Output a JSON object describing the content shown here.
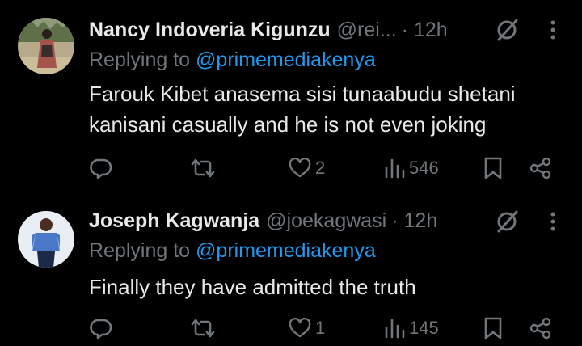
{
  "replies": [
    {
      "name": "Nancy Indoveria Kigunzu",
      "handle": "@rei...",
      "time": "· 12h",
      "replying_prefix": "Replying to ",
      "replying_to": "@primemediakenya",
      "text_lines": [
        "Farouk Kibet anasema sisi tunaabudu shetani",
        "kanisani casually and he is not even joking"
      ],
      "counts": {
        "reply": "",
        "repost": "",
        "like": "2",
        "views": "546"
      },
      "icons": [
        "reply-icon",
        "repost-icon",
        "like-icon",
        "views-icon",
        "bookmark-icon",
        "share-icon",
        "grok-icon",
        "more-icon"
      ]
    },
    {
      "name": "Joseph Kagwanja",
      "handle": "@joekagwasi",
      "time": "· 12h",
      "replying_prefix": "Replying to ",
      "replying_to": "@primemediakenya",
      "text_lines": [
        "Finally they have admitted the truth"
      ],
      "counts": {
        "reply": "",
        "repost": "",
        "like": "1",
        "views": "145"
      },
      "icons": [
        "reply-icon",
        "repost-icon",
        "like-icon",
        "views-icon",
        "bookmark-icon",
        "share-icon",
        "grok-icon",
        "more-icon"
      ]
    }
  ],
  "colors": {
    "background": "#000000",
    "text": "#e7e9ea",
    "muted": "#71767b",
    "link": "#1d9bf0",
    "divider": "#2f3336"
  }
}
